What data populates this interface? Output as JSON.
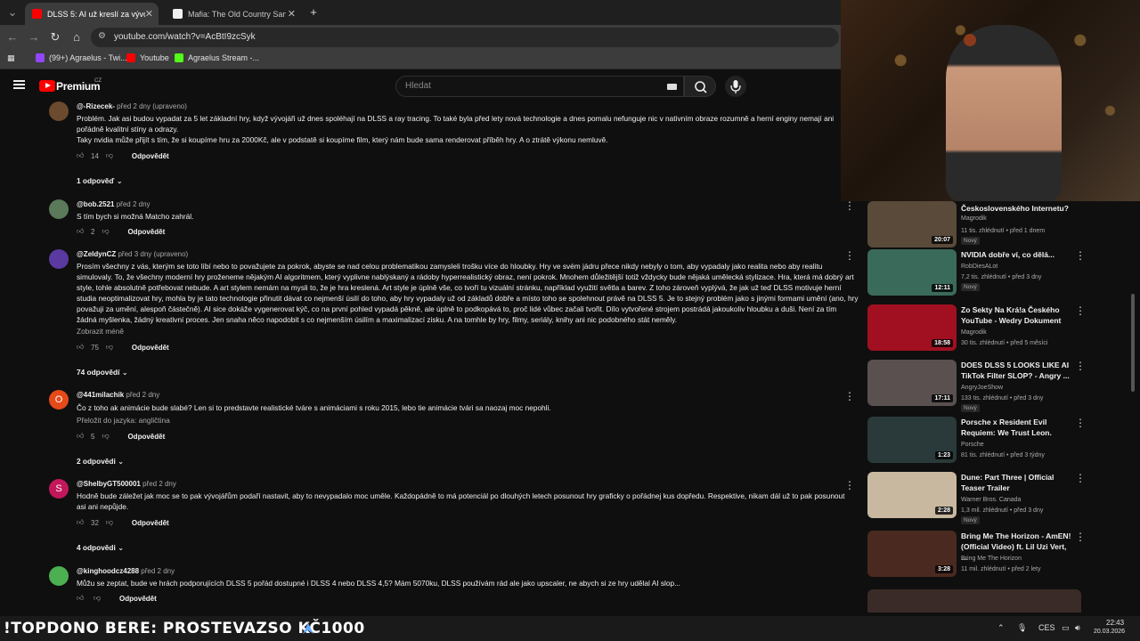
{
  "browser": {
    "tabs": [
      {
        "title": "DLSS 5: AI už kreslí za vývojáře",
        "active": true,
        "color": "#ff0000"
      },
      {
        "title": "Mafia: The Old Country San Celeste",
        "active": false,
        "color": "#ffffff"
      }
    ],
    "url": "youtube.com/watch?v=AcBtI9zcSyk",
    "bookmarks": [
      "(99+) Agraelus - Twi...",
      "Youtube",
      "Agraelus Stream -..."
    ]
  },
  "youtube": {
    "logo_text": "Premium",
    "country": "CZ",
    "search_placeholder": "Hledat"
  },
  "comments": [
    {
      "author": "@-Rizecek-",
      "time": "před 2 dny (upraveno)",
      "text": [
        "Problém. Jak asi budou vypadat za 5 let základní hry, když vývojáři už dnes spoléhají na DLSS a ray tracing. To také byla před lety nová technologie a dnes pomalu nefunguje nic v nativním obraze rozumně a herní enginy nemají ani pořádně kvalitní stíny a odrazy.",
        "Taky nvidia může přijít s tím, že si koupíme hru za 2000Kč, ale v podstatě si koupíme film, který nám bude sama renderovat příběh hry. A o ztrátě výkonu nemluvě."
      ],
      "likes": "14",
      "reply_label": "Odpovědět",
      "replies": "1 odpověď",
      "avatar_color": "#6b4a2e"
    },
    {
      "author": "@bob.2521",
      "time": "před 2 dny",
      "text": [
        "S tím bych si možná Matcho zahrál."
      ],
      "likes": "2",
      "reply_label": "Odpovědět",
      "replies": "",
      "avatar_color": "#5a7a5a"
    },
    {
      "author": "@ZeldynCZ",
      "time": "před 3 dny (upraveno)",
      "text": [
        "Prosím všechny z vás, kterým se toto líbí nebo to považujete za pokrok, abyste se nad celou problematikou zamysleli trošku více do hloubky. Hry ve svém jádru přece nikdy nebyly o tom, aby vypadaly jako realita nebo aby realitu simulovaly. To, že všechny moderní hry proženeme nějakým AI algoritmem, který vyplivne nablýskaný a rádoby hyperrealistický obraz, není pokrok. Mnohem důležitější totiž vždycky bude nějaká umělecká stylizace. Hra, která má dobrý art style, tohle absolutně potřebovat nebude. A art stylem nemám na mysli to, že je hra kreslená. Art style je úplně vše, co tvoří tu vizuální stránku, například využití světla a barev. Z toho zároveň vyplývá, že jak už teď DLSS motivuje herní studia neoptimalizovat hry, mohla by je tato technologie přinutit dávat co nejmenší úsilí do toho, aby hry vypadaly už od základů dobře a místo toho se spolehnout právě na DLSS 5. Je to stejný problém jako s jinými formami umění (ano, hry považuji za umění, alespoň částečně). AI sice dokáže vygenerovat kýč, co na první pohled vypadá pěkně, ale úplně to podkopává to, proč lidé vůbec začali tvořit. Dílo vytvořené strojem postrádá jakoukoliv hloubku a duši. Není za tím žádná myšlenka, žádný kreativní proces. Jen snaha něco napodobit s co nejmenším úsilím a maximalizací zisku. A na tomhle by hry, filmy, seriály, knihy ani nic podobného stát neměly."
      ],
      "show_less": "Zobrazit méně",
      "likes": "75",
      "reply_label": "Odpovědět",
      "replies": "74 odpovědí",
      "avatar_color": "#5a3aa0"
    },
    {
      "author": "@441milachik",
      "time": "před 2 dny",
      "text": [
        "Čo z toho ak animácie bude slabé? Len si to predstavte realistické tváre s animáciami s roku 2015, lebo tie animácie tvári sa naozaj moc nepohli."
      ],
      "translate": "Přeložit do jazyka: angličtina",
      "likes": "5",
      "reply_label": "Odpovědět",
      "replies": "2 odpovědi",
      "avatar_letter": "O",
      "avatar_color": "#e64a19"
    },
    {
      "author": "@ShelbyGT500001",
      "time": "před 2 dny",
      "text": [
        "Hodně bude záležet jak moc se to pak vývojářům podaří nastavit, aby to nevypadalo moc uměle. Každopádně to má potenciál po dlouhých letech posunout hry graficky o pořádnej kus dopředu. Respektive, nikam dál už to pak posunout asi ani nepůjde."
      ],
      "likes": "32",
      "reply_label": "Odpovědět",
      "replies": "4 odpovědi",
      "avatar_letter": "S",
      "avatar_color": "#c2185b"
    },
    {
      "author": "@kinghoodcz4288",
      "time": "před 2 dny",
      "text": [
        "Můžu se zeptat, bude ve hrách podporujících DLSS 5 pořád dostupné i DLSS 4 nebo DLSS 4,5? Mám 5070ku, DLSS používám rád ale jako upscaler, ne abych si ze hry udělal AI slop..."
      ],
      "likes": "",
      "reply_label": "Odpovědět",
      "replies": "",
      "avatar_color": "#4caf50"
    }
  ],
  "recommendations": [
    {
      "title": "Československého Internetu?",
      "channel": "Magrodik",
      "stats": "11 tis. zhlédnutí • před 1 dnem",
      "duration": "20:07",
      "new": "Nový",
      "color": "#5a4a3a"
    },
    {
      "title": "NVIDIA dobře ví, co dělá...",
      "channel": "RobDiesALot",
      "stats": "7,2 tis. zhlédnutí • před 3 dny",
      "duration": "12:11",
      "new": "Nový",
      "color": "#3a6a5a"
    },
    {
      "title": "Zo Sekty Na Krá!a Českého YouTube - Wedry Dokument",
      "channel": "Magrodik",
      "stats": "30 tis. zhlédnutí • před 5 měsíci",
      "duration": "18:58",
      "new": "",
      "color": "#a01020"
    },
    {
      "title": "DOES DLSS 5 LOOKS LIKE AI TikTok Filter SLOP? - Angry ...",
      "channel": "AngryJoeShow",
      "stats": "133 tis. zhlédnutí • před 3 dny",
      "duration": "17:11",
      "new": "Nový",
      "color": "#5a5050"
    },
    {
      "title": "Porsche x Resident Evil Requiem: We Trust Leon.",
      "channel": "Porsche",
      "stats": "81 tis. zhlédnutí • před 3 týdny",
      "duration": "1:23",
      "new": "",
      "color": "#2a3a3a"
    },
    {
      "title": "Dune: Part Three | Official Teaser Trailer",
      "channel": "Warner Bros. Canada",
      "stats": "1,3 mil. zhlédnutí • před 3 dny",
      "duration": "2:28",
      "new": "Nový",
      "color": "#c8b8a0"
    },
    {
      "title": "Bring Me The Horizon - AmEN! (Official Video) ft. Lil Uzi Vert, ...",
      "channel": "Bring Me The Horizon",
      "stats": "11 mil. zhlédnutí • před 2 lety",
      "duration": "3:28",
      "new": "",
      "color": "#4a2a20"
    }
  ],
  "taskbar": {
    "ticker": "!TOPDONO BERE: PROSTEVAZSO KČ1000",
    "lang": "CES",
    "time": "22:43",
    "date": "20.03.2026"
  }
}
